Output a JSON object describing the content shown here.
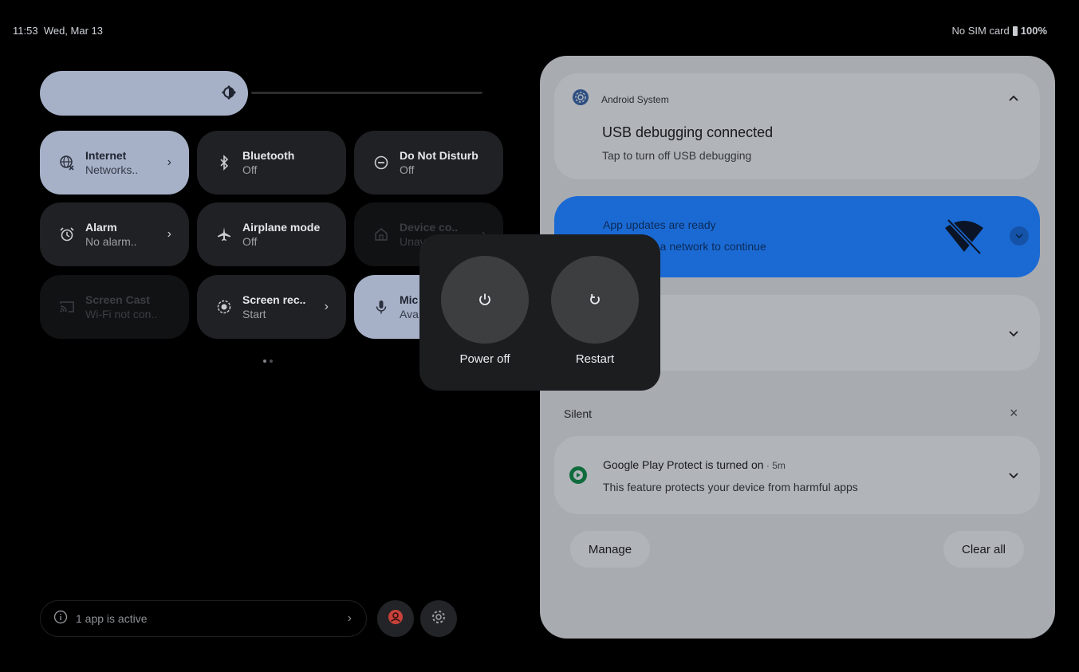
{
  "status_bar": {
    "time": "11:53",
    "date": "Wed, Mar 13",
    "sim": "No SIM card",
    "battery": "100%"
  },
  "brightness": {
    "level": 0.47
  },
  "tiles": [
    {
      "label": "Internet",
      "sub": "Networks..",
      "state": "on",
      "icon": "internet-off-icon",
      "chevron": true
    },
    {
      "label": "Bluetooth",
      "sub": "Off",
      "state": "off",
      "icon": "bluetooth-icon",
      "chevron": false
    },
    {
      "label": "Do Not Disturb",
      "sub": "Off",
      "state": "off",
      "icon": "do-not-disturb-icon",
      "chevron": false
    },
    {
      "label": "Alarm",
      "sub": "No alarm..",
      "state": "off",
      "icon": "alarm-icon",
      "chevron": true
    },
    {
      "label": "Airplane mode",
      "sub": "Off",
      "state": "off",
      "icon": "airplane-icon",
      "chevron": false
    },
    {
      "label": "Device co..",
      "sub": "Unav",
      "state": "dim",
      "icon": "home-icon",
      "chevron": true
    },
    {
      "label": "Screen Cast",
      "sub": "Wi-Fi not con..",
      "state": "dim",
      "icon": "cast-icon",
      "chevron": false
    },
    {
      "label": "Screen rec..",
      "sub": "Start",
      "state": "off",
      "icon": "screen-record-icon",
      "chevron": true
    },
    {
      "label": "Mic",
      "sub": "Ava",
      "state": "on",
      "icon": "mic-icon",
      "chevron": false
    }
  ],
  "footer": {
    "active_apps": "1 app is active"
  },
  "notifications": {
    "usb": {
      "app": "Android System",
      "title": "USB debugging connected",
      "text": "Tap to turn off USB debugging"
    },
    "updates": {
      "title": "App updates are ready",
      "text": "o a network to continue"
    },
    "silent_header": "Silent",
    "gpp": {
      "title": "Google Play Protect is turned on",
      "time": " · 5m",
      "text": "This feature protects your device from harmful apps"
    },
    "manage": "Manage",
    "clear_all": "Clear all"
  },
  "power_dialog": {
    "power_off": "Power off",
    "restart": "Restart"
  },
  "colors": {
    "tile_on": "#a6b1c8",
    "tile_off": "#202124",
    "shade": "#a8acb1",
    "updates_card": "#1b6ad4",
    "power_dialog": "#1c1d1f"
  }
}
